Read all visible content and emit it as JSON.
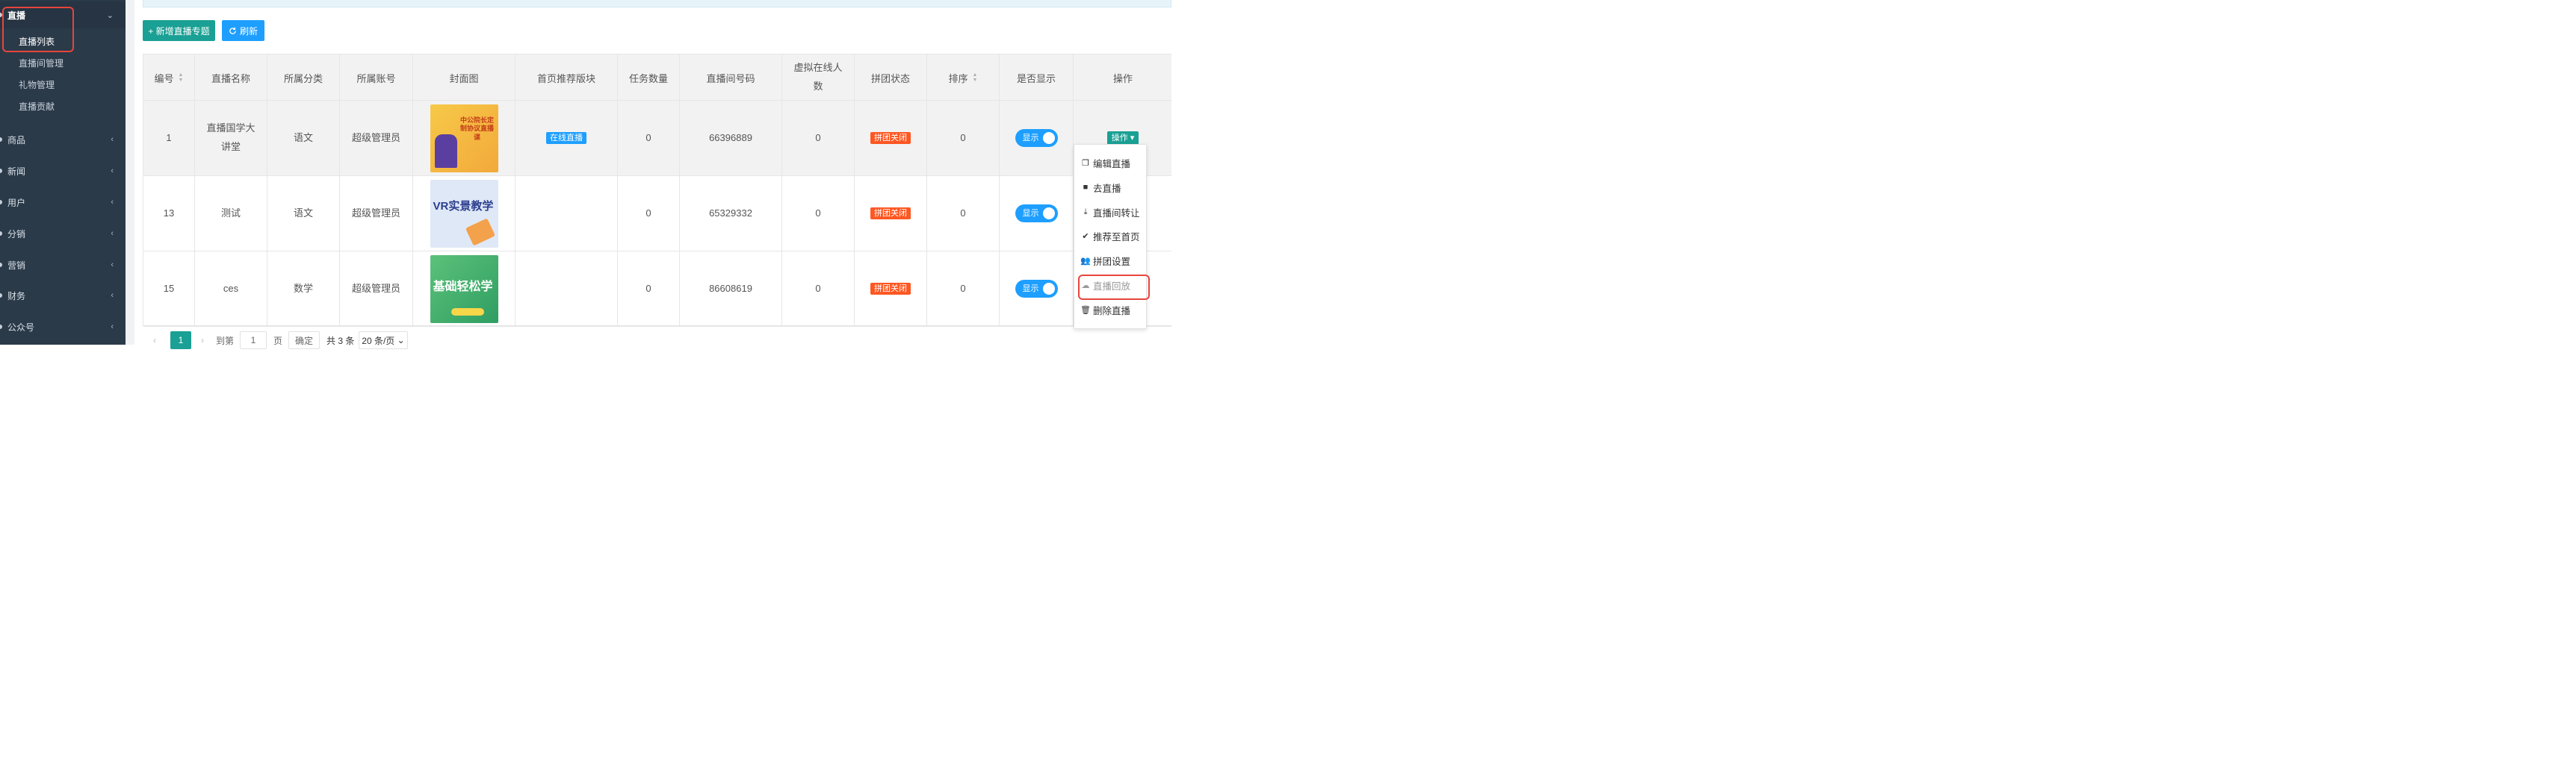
{
  "sidebar": {
    "groups": [
      {
        "label": "直播",
        "arrow": "⌄"
      },
      {
        "label": "商品",
        "arrow": "‹"
      },
      {
        "label": "新闻",
        "arrow": "‹"
      },
      {
        "label": "用户",
        "arrow": "‹"
      },
      {
        "label": "分销",
        "arrow": "‹"
      },
      {
        "label": "营销",
        "arrow": "‹"
      },
      {
        "label": "财务",
        "arrow": "‹"
      },
      {
        "label": "公众号",
        "arrow": "‹"
      }
    ],
    "live_items": [
      {
        "label": "直播列表"
      },
      {
        "label": "直播间管理"
      },
      {
        "label": "礼物管理"
      },
      {
        "label": "直播贡献"
      }
    ]
  },
  "toolbar": {
    "add_label": "+ 新增直播专题",
    "refresh_label": "刷新"
  },
  "table": {
    "headers": [
      "编号",
      "直播名称",
      "所属分类",
      "所属账号",
      "封面图",
      "首页推荐版块",
      "任务数量",
      "直播间号码",
      "虚拟在线人数",
      "拼团状态",
      "排序",
      "是否显示",
      "操作"
    ],
    "rows": [
      {
        "id": "1",
        "name": "直播国学大讲堂",
        "category": "语文",
        "account": "超级管理员",
        "cover_text": "中公院长定制协议直播课",
        "recommend": "在线直播",
        "tasks": "0",
        "room": "66396889",
        "virtual": "0",
        "group": "拼团关闭",
        "sort": "0",
        "show": "显示",
        "op": "操作"
      },
      {
        "id": "13",
        "name": "测试",
        "category": "语文",
        "account": "超级管理员",
        "cover_text": "VR实景教学",
        "recommend": "",
        "tasks": "0",
        "room": "65329332",
        "virtual": "0",
        "group": "拼团关闭",
        "sort": "0",
        "show": "显示",
        "op": ""
      },
      {
        "id": "15",
        "name": "ces",
        "category": "数学",
        "account": "超级管理员",
        "cover_text": "基础轻松学",
        "recommend": "",
        "tasks": "0",
        "room": "86608619",
        "virtual": "0",
        "group": "拼团关闭",
        "sort": "0",
        "show": "显示",
        "op": ""
      }
    ]
  },
  "dropdown": {
    "items": [
      {
        "label": "编辑直播"
      },
      {
        "label": "去直播"
      },
      {
        "label": "直播间转让"
      },
      {
        "label": "推荐至首页"
      },
      {
        "label": "拼团设置"
      },
      {
        "label": "直播回放"
      },
      {
        "label": "删除直播"
      }
    ]
  },
  "pager": {
    "current": "1",
    "goto_label": "到第",
    "page_value": "1",
    "page_label": "页",
    "confirm_label": "确定",
    "total_label": "共 3 条",
    "size_label": "20 条/页"
  },
  "colors": {
    "sidebar_bg": "#2b3a49",
    "green": "#1aa094",
    "blue": "#1e9fff",
    "red_tag": "#ff5722",
    "highlight": "#e8453c"
  }
}
